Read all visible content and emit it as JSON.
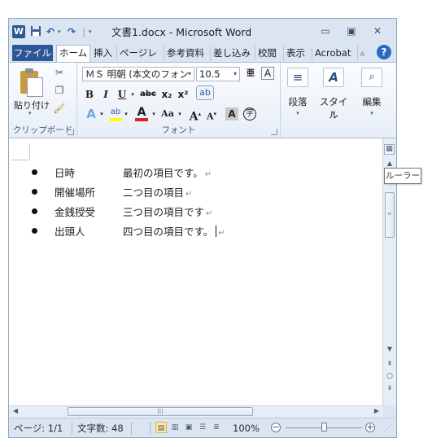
{
  "window": {
    "title": "文書1.docx - Microsoft Word",
    "app_icon": "W"
  },
  "quick_access": {
    "save_icon": "save-icon",
    "undo_icon": "undo-icon",
    "redo_icon": "redo-icon"
  },
  "tabs": {
    "file": "ファイル",
    "items": [
      "ホーム",
      "挿入",
      "ページレ",
      "参考資料",
      "差し込み",
      "校閲",
      "表示",
      "Acrobat"
    ],
    "active": "ホーム",
    "help": "?"
  },
  "ribbon": {
    "clipboard": {
      "label": "クリップボード",
      "paste_label": "貼り付け"
    },
    "font": {
      "label": "フォント",
      "font_name": "ＭＳ 明朝 (本文のフォン",
      "font_size": "10.5",
      "bold": "B",
      "italic": "I",
      "underline": "U",
      "strikethrough": "abc",
      "subscript": "x₂",
      "superscript": "x²",
      "case": "Aa",
      "grow": "A",
      "shrink": "A",
      "highlight_color": "#ffff00",
      "font_color": "#e02020"
    },
    "paragraph": {
      "label": "段落"
    },
    "styles": {
      "label": "スタイル"
    },
    "editing": {
      "label": "編集"
    }
  },
  "document": {
    "items": [
      {
        "label": "日時",
        "value": "最初の項目です。"
      },
      {
        "label": "開催場所",
        "value": "二つ目の項目"
      },
      {
        "label": "金銭授受",
        "value": "三つ目の項目です"
      },
      {
        "label": "出頭人",
        "value": "四つ目の項目です。"
      }
    ],
    "paragraph_mark": "↵"
  },
  "tooltip": "ルーラー",
  "status": {
    "page": "ページ: 1/1",
    "words": "文字数: 48",
    "zoom": "100%"
  }
}
